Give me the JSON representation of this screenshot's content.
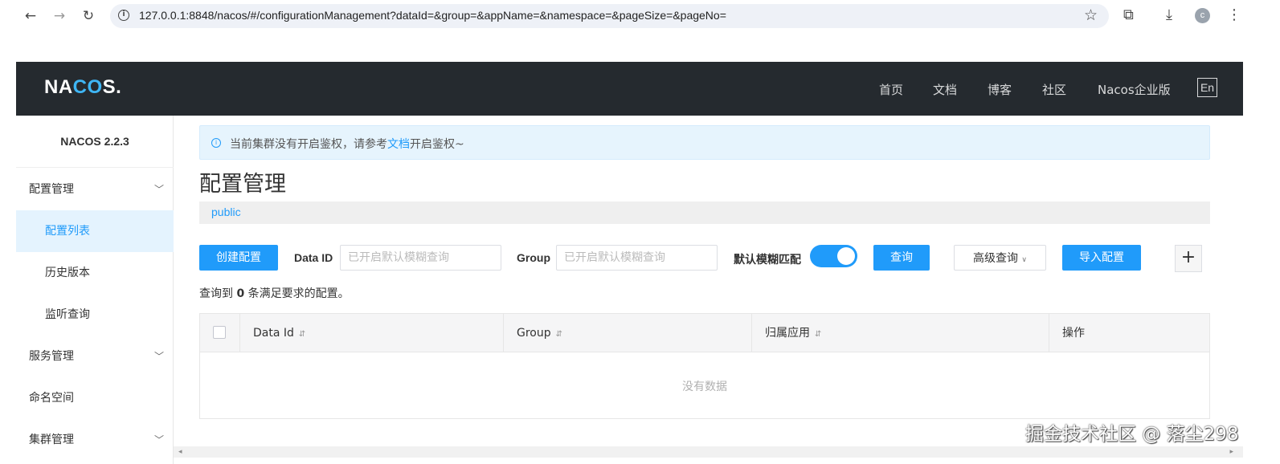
{
  "browser": {
    "url": "127.0.0.1:8848/nacos/#/configurationManagement?dataId=&group=&appName=&namespace=&pageSize=&pageNo=",
    "profile_initial": "c"
  },
  "header": {
    "logo_pre": "NA",
    "logo_c": "CO",
    "logo_post": "S.",
    "nav": [
      "首页",
      "文档",
      "博客",
      "社区",
      "Nacos企业版"
    ],
    "lang": "En"
  },
  "sidebar": {
    "version": "NACOS 2.2.3",
    "items": [
      {
        "label": "配置管理"
      },
      {
        "label": "配置列表"
      },
      {
        "label": "历史版本"
      },
      {
        "label": "监听查询"
      },
      {
        "label": "服务管理"
      },
      {
        "label": "命名空间"
      },
      {
        "label": "集群管理"
      }
    ]
  },
  "alert": {
    "text_before": "当前集群没有开启鉴权，请参考",
    "link": "文档",
    "text_after": "开启鉴权~"
  },
  "main": {
    "title": "配置管理",
    "namespace": "public",
    "create_button": "创建配置",
    "data_id_label": "Data ID",
    "data_id_placeholder": "已开启默认模糊查询",
    "group_label": "Group",
    "group_placeholder": "已开启默认模糊查询",
    "fuzzy_label": "默认模糊匹配",
    "fuzzy_enabled": true,
    "query_button": "查询",
    "advanced_query": "高级查询",
    "import_button": "导入配置",
    "plus_button": "+",
    "result_prefix": "查询到",
    "result_count": "0",
    "result_suffix": "条满足要求的配置。"
  },
  "table": {
    "columns": [
      "Data Id",
      "Group",
      "归属应用",
      "操作"
    ],
    "empty_text": "没有数据"
  },
  "watermark": "掘金技术社区 @ 落尘298"
}
